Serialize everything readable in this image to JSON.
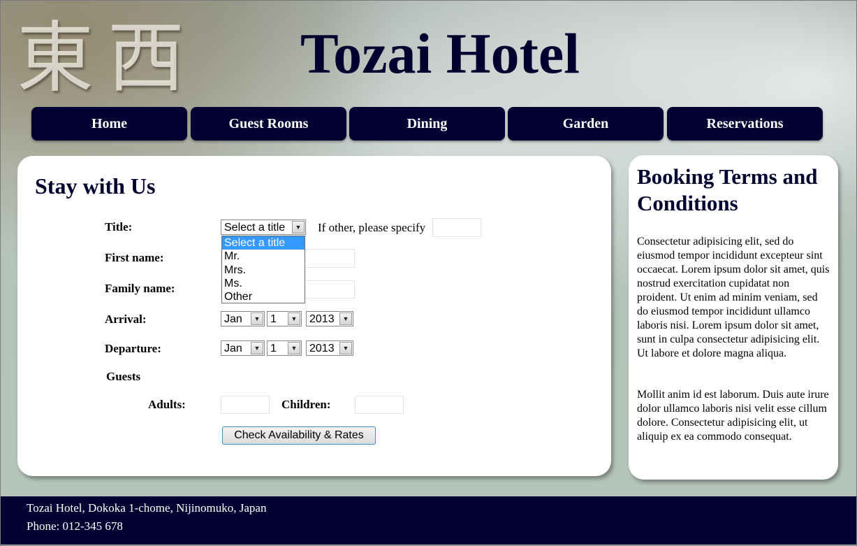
{
  "header": {
    "logo_chars": "東西",
    "site_title": "Tozai Hotel"
  },
  "nav": {
    "items": [
      "Home",
      "Guest Rooms",
      "Dining",
      "Garden",
      "Reservations"
    ]
  },
  "form": {
    "heading": "Stay with Us",
    "title_label": "Title:",
    "title_select_value": "Select a title",
    "title_options": [
      "Select a title",
      "Mr.",
      "Mrs.",
      "Ms.",
      "Other"
    ],
    "other_label": "If other, please specify",
    "first_name_label": "First name:",
    "family_name_label": "Family name:",
    "arrival_label": "Arrival:",
    "departure_label": "Departure:",
    "arrival": {
      "month": "Jan",
      "day": "1",
      "year": "2013"
    },
    "departure": {
      "month": "Jan",
      "day": "1",
      "year": "2013"
    },
    "guests_label": "Guests",
    "adults_label": "Adults:",
    "children_label": "Children:",
    "submit_label": "Check Availability & Rates"
  },
  "sidebar": {
    "heading": "Booking Terms and Conditions",
    "para1": "Consectetur adipisicing elit, sed do eiusmod tempor incididunt excepteur sint occaecat. Lorem ipsum dolor sit amet, quis nostrud exercitation cupidatat non proident. Ut enim ad minim veniam, sed do eiusmod tempor incididunt ullamco laboris nisi. Lorem ipsum dolor sit amet, sunt in culpa consectetur adipisicing elit. Ut labore et dolore magna aliqua.",
    "para2": "Mollit anim id est laborum. Duis aute irure dolor ullamco laboris nisi velit esse cillum dolore. Consectetur adipisicing elit, ut aliquip ex ea commodo consequat."
  },
  "footer": {
    "address": "Tozai Hotel, Dokoka 1-chome, Nijinomuko, Japan",
    "phone": "Phone: 012-345 678"
  },
  "colors": {
    "brand_navy": "#010030",
    "selected_option": "#3399ff"
  },
  "icons": {
    "select_arrow": "chevron-down-icon"
  }
}
